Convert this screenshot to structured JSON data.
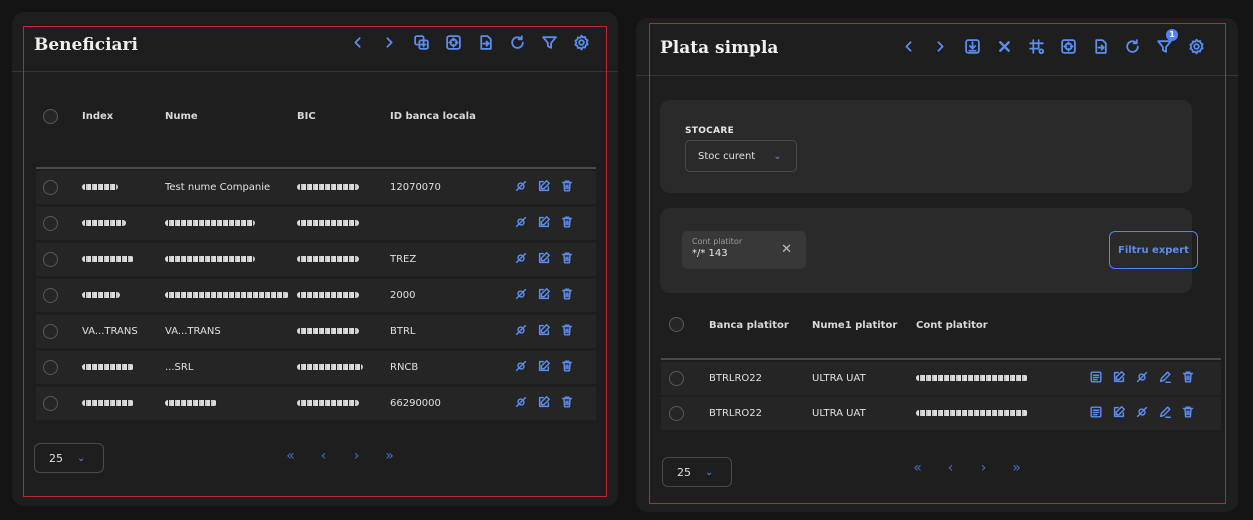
{
  "left": {
    "title": "Beneficiari",
    "columns": [
      "Index",
      "Nume",
      "BIC",
      "ID banca locala"
    ],
    "rows": [
      {
        "index": "",
        "nume": "Test nume Companie",
        "bic": "",
        "id": "12070070",
        "index_mask": 36,
        "bic_mask": 62
      },
      {
        "index": "",
        "nume": "",
        "bic": "",
        "id": "",
        "index_mask": 44,
        "nume_mask": 90,
        "bic_mask": 62
      },
      {
        "index": "",
        "nume": "",
        "bic": "",
        "id": "TREZ",
        "index_mask": 52,
        "nume_mask": 90,
        "bic_mask": 62
      },
      {
        "index": "",
        "nume": "",
        "bic": "",
        "id": "2000",
        "index_mask": 38,
        "nume_mask": 124,
        "bic_mask": 62
      },
      {
        "index": "VA...TRANS",
        "nume": "VA...TRANS",
        "bic": "",
        "id": "BTRL",
        "bic_mask": 62
      },
      {
        "index": "",
        "nume": "...SRL",
        "bic": "",
        "id": "RNCB",
        "index_mask": 52,
        "bic_mask": 66
      },
      {
        "index": "",
        "nume": "",
        "bic": "",
        "id": "66290000",
        "index_mask": 52,
        "nume_mask": 52,
        "bic_mask": 62
      }
    ],
    "page_size": "25",
    "pager": [
      "«",
      "‹",
      "›",
      "»"
    ]
  },
  "right": {
    "title": "Plata simpla",
    "filter_badge": "1",
    "stocare_label": "STOCARE",
    "stocare_value": "Stoc curent",
    "chip_label": "Cont platitor",
    "chip_value": "*/* 143",
    "chip_clear": "✕",
    "expert_button": "Filtru expert",
    "columns": [
      "Banca platitor",
      "Nume1 platitor",
      "Cont platitor"
    ],
    "rows": [
      {
        "banca": "BTRLRO22",
        "nume": "ULTRA UAT"
      },
      {
        "banca": "BTRLRO22",
        "nume": "ULTRA UAT"
      }
    ],
    "page_size": "25",
    "pager": [
      "«",
      "‹",
      "›",
      "»"
    ]
  },
  "colors": {
    "accent": "#5b8def",
    "frame": "#c0272d",
    "panel": "#1e1e1e",
    "background": "#141414"
  },
  "icons": {
    "left_toolbar": [
      "chevron-left-icon",
      "chevron-right-icon",
      "copy-add-icon",
      "target-icon",
      "file-export-icon",
      "refresh-icon",
      "filter-icon",
      "settings-icon"
    ],
    "right_toolbar": [
      "chevron-left-icon",
      "chevron-right-icon",
      "download-icon",
      "close-icon",
      "grid-settings-icon",
      "target-icon",
      "file-export-icon",
      "refresh-icon",
      "filter-icon",
      "settings-icon"
    ],
    "left_row_actions": [
      "unlink-icon",
      "edit-icon",
      "trash-icon"
    ],
    "right_row_actions": [
      "details-icon",
      "edit-icon",
      "unlink-icon",
      "pencil-icon",
      "trash-icon"
    ]
  }
}
